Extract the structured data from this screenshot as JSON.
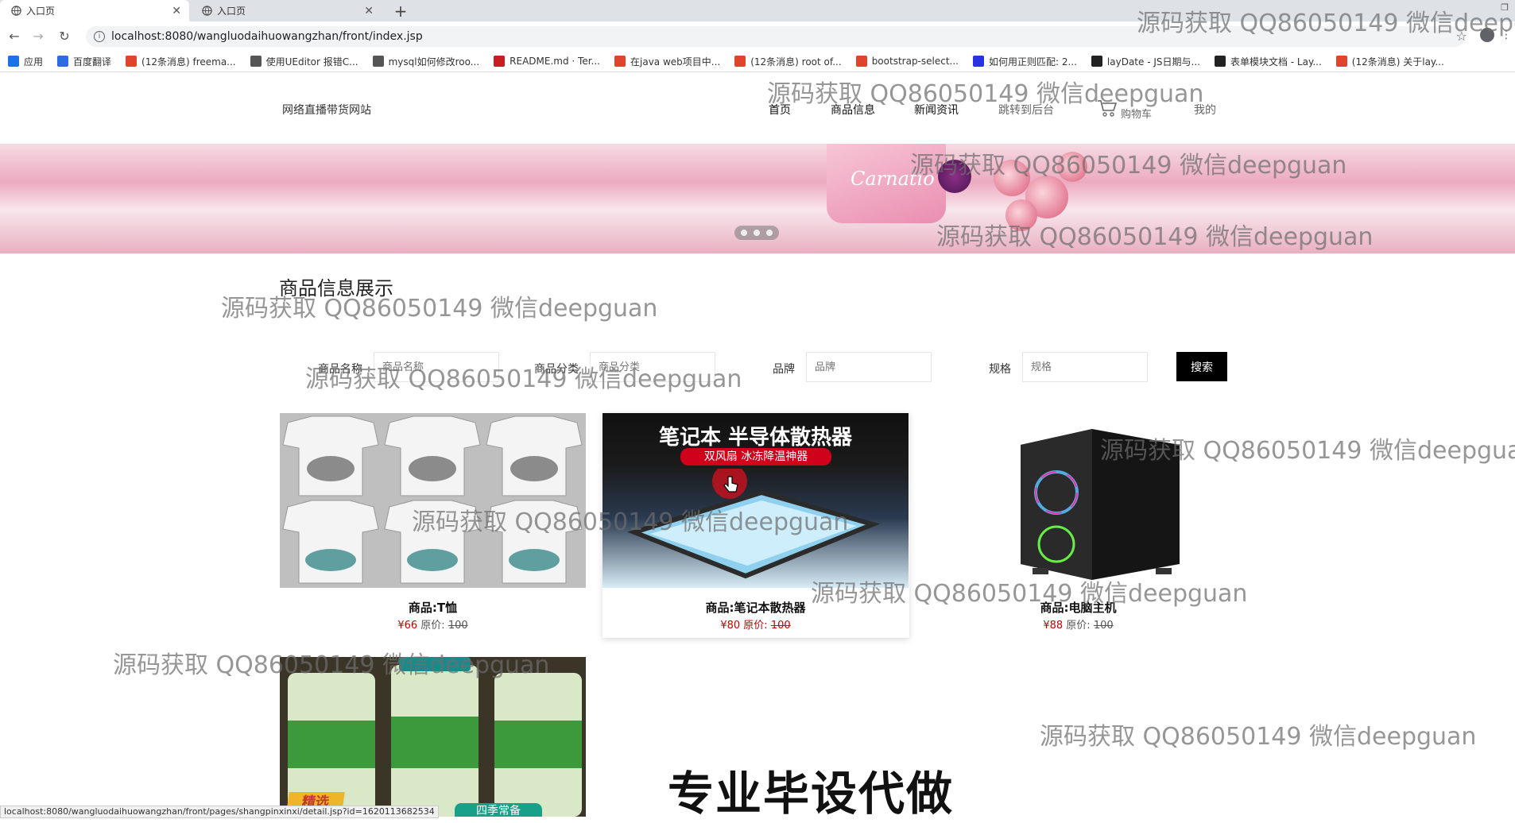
{
  "browser": {
    "tabs": [
      {
        "title": "入口页"
      },
      {
        "title": "入口页"
      }
    ],
    "url": "localhost:8080/wangluodaihuowangzhan/front/index.jsp",
    "bookmarks": [
      {
        "label": "应用",
        "icon": "apps-grid-icon",
        "color": "#1a73e8"
      },
      {
        "label": "百度翻译",
        "icon": "baidu-translate-icon",
        "color": "#2f6be0"
      },
      {
        "label": "(12条消息) freema...",
        "icon": "csdn-icon",
        "color": "#e0442c"
      },
      {
        "label": "使用UEditor 报错C...",
        "icon": "link-icon",
        "color": "#555555"
      },
      {
        "label": "mysql如何修改roo...",
        "icon": "link-icon",
        "color": "#555555"
      },
      {
        "label": "README.md · Ter...",
        "icon": "gitee-icon",
        "color": "#c71d23"
      },
      {
        "label": "在java web项目中...",
        "icon": "csdn-icon",
        "color": "#e0442c"
      },
      {
        "label": "(12条消息) root of...",
        "icon": "csdn-icon",
        "color": "#e0442c"
      },
      {
        "label": "bootstrap-select...",
        "icon": "bookmark-icon",
        "color": "#e0442c"
      },
      {
        "label": "如何用正则匹配: 2...",
        "icon": "baidu-icon",
        "color": "#2932e1"
      },
      {
        "label": "layDate - JS日期与...",
        "icon": "layui-icon",
        "color": "#222222"
      },
      {
        "label": "表单模块文档 - Lay...",
        "icon": "layui-icon",
        "color": "#222222"
      },
      {
        "label": "(12条消息) 关于lay...",
        "icon": "csdn-icon",
        "color": "#e0442c"
      }
    ],
    "status_url": "localhost:8080/wangluodaihuowangzhan/front/pages/shangpinxinxi/detail.jsp?id=1620113682534"
  },
  "site": {
    "title": "网络直播带货网站",
    "nav": [
      {
        "label": "首页"
      },
      {
        "label": "商品信息"
      },
      {
        "label": "新闻资讯"
      },
      {
        "label": "跳转到后台"
      },
      {
        "label": "购物车"
      },
      {
        "label": "我的"
      }
    ]
  },
  "banner": {
    "product_text": "Carnatio"
  },
  "section": {
    "title": "商品信息展示"
  },
  "filters": [
    {
      "label": "商品名称",
      "placeholder": "商品名称"
    },
    {
      "label": "商品分类",
      "placeholder": "商品分类"
    },
    {
      "label": "品牌",
      "placeholder": "品牌"
    },
    {
      "label": "规格",
      "placeholder": "规格"
    }
  ],
  "search_label": "搜索",
  "products": [
    {
      "name": "商品:T恤",
      "price": "¥66",
      "orig_label": "原价:",
      "orig_price": "100"
    },
    {
      "name": "商品:笔记本散热器",
      "price": "¥80",
      "orig_label": "原价:",
      "orig_price": "100",
      "img_title": "笔记本 半导体散热器",
      "img_sub": "双风扇 冰冻降温神器"
    },
    {
      "name": "商品:电脑主机",
      "price": "¥88",
      "orig_label": "原价:",
      "orig_price": "100"
    },
    {
      "badge": "精选",
      "badge2": "四季常备"
    }
  ],
  "overlay": {
    "watermark": "源码获取 QQ86050149 微信deepguan",
    "big_text": "专业毕设代做"
  },
  "colors": {
    "accent": "#000000",
    "price": "#cc0000"
  }
}
